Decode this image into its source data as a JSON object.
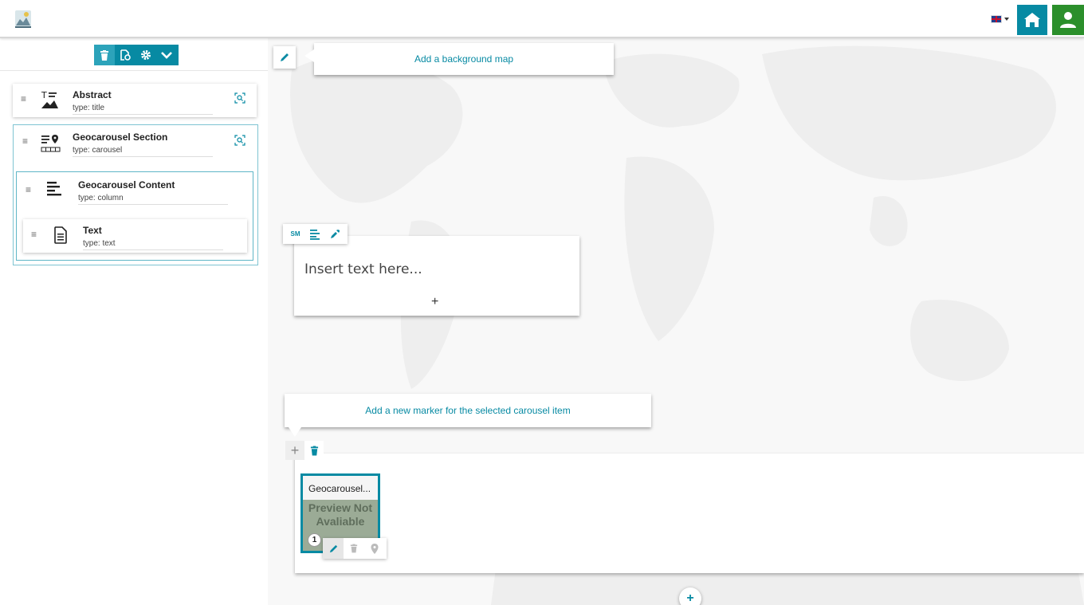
{
  "topbar": {
    "logo_icon": "geostory-logo-icon",
    "language": "en-GB",
    "home_icon": "home-icon",
    "user_icon": "user-icon"
  },
  "left_panel": {
    "toolbar": {
      "buttons": [
        "trash-icon",
        "preview-icon",
        "gear-icon",
        "chevron-down-icon"
      ]
    },
    "nodes": [
      {
        "title": "Abstract",
        "type_label": "type: title"
      },
      {
        "title": "Geocarousel Section",
        "type_label": "type: carousel"
      },
      {
        "title": "Geocarousel Content",
        "type_label": "type: column"
      },
      {
        "title": "Text",
        "type_label": "type: text"
      }
    ]
  },
  "content": {
    "background_map_tip": "Add a background map",
    "text_tools": {
      "size_label": "SM"
    },
    "text_placeholder": "Insert text here...",
    "add_block_label": "+",
    "marker_tip": "Add a new marker for the selected carousel item",
    "carousel": {
      "add_label": "+",
      "items": [
        {
          "caption": "Geocarousel...",
          "preview_text": "Preview Not Avaliable",
          "index": "1"
        }
      ]
    },
    "add_section_label": "+"
  },
  "colors": {
    "accent": "#078aa3",
    "user_green": "#2b8f2b"
  }
}
